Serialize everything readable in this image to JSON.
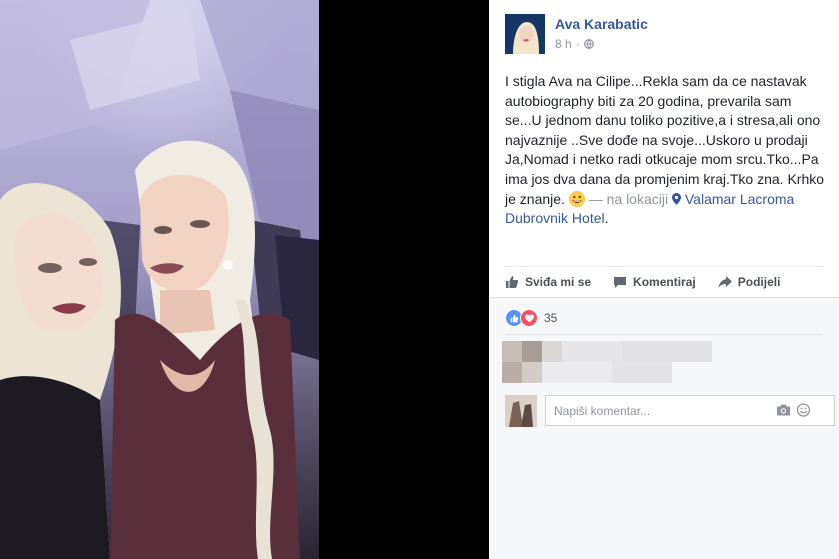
{
  "post": {
    "author": "Ava Karabatic",
    "time": "8 h",
    "text_main": "I stigla Ava na Cilipe...Rekla sam da ce nastavak autobiography biti za 20 godina, prevarila sam se...U jednom danu toliko pozitive,a i stresa,ali ono najvaznije ..Sve dođe na svoje...Uskoro u prodaji Ja,Nomad i netko radi otkucaje mom srcu.Tko...Pa ima jos dva dana da promjenim kraj.Tko zna. Krhko je znanje.",
    "location_prefix": "— na lokaciji",
    "location": "Valamar Lacroma Dubrovnik Hotel",
    "location_suffix": "."
  },
  "actions": {
    "like": "Sviđa mi se",
    "comment": "Komentiraj",
    "share": "Podijeli"
  },
  "reactions": {
    "count": "35"
  },
  "comment_input": {
    "placeholder": "Napiši komentar..."
  },
  "colors": {
    "link": "#365899",
    "like": "#5890ff",
    "love": "#f25268"
  }
}
